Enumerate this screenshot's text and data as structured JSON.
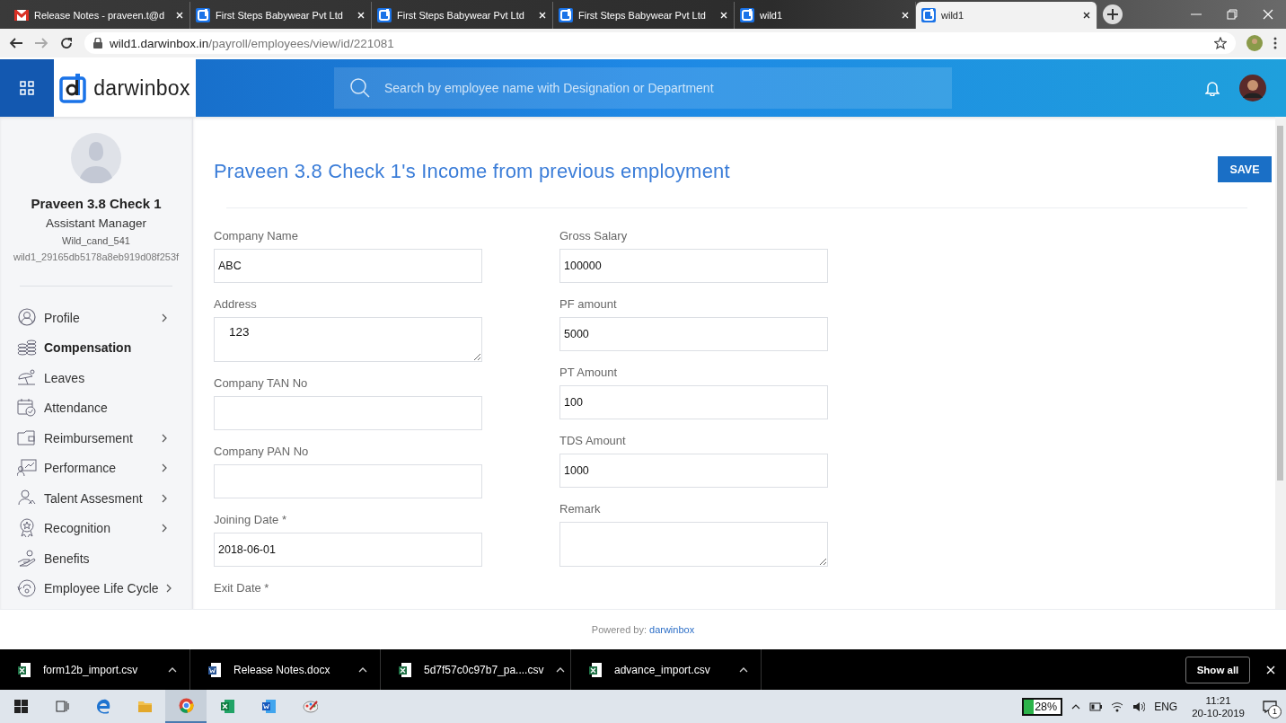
{
  "browser": {
    "tabs": [
      {
        "title": "Release Notes - praveen.t@d",
        "kind": "mail",
        "selected": false
      },
      {
        "title": "First Steps Babywear Pvt Ltd",
        "kind": "site",
        "selected": false
      },
      {
        "title": "First Steps Babywear Pvt Ltd",
        "kind": "site",
        "selected": false
      },
      {
        "title": "First Steps Babywear Pvt Ltd",
        "kind": "site",
        "selected": false
      },
      {
        "title": "wild1",
        "kind": "site",
        "selected": false
      },
      {
        "title": "wild1",
        "kind": "site",
        "selected": true
      }
    ],
    "host": "wild1.darwinbox.in",
    "path": "/payroll/employees/view/id/221081"
  },
  "header": {
    "logo": "darwinbox",
    "search_placeholder": "Search by employee name with Designation or Department"
  },
  "employee": {
    "name": "Praveen 3.8 Check 1",
    "designation": "Assistant Manager",
    "code": "Wild_cand_541",
    "id": "wild1_29165db5178a8eb919d08f253f"
  },
  "nav": [
    {
      "label": "Profile",
      "selected": false,
      "expandable": true
    },
    {
      "label": "Compensation",
      "selected": true,
      "expandable": false
    },
    {
      "label": "Leaves",
      "selected": false,
      "expandable": false
    },
    {
      "label": "Attendance",
      "selected": false,
      "expandable": false
    },
    {
      "label": "Reimbursement",
      "selected": false,
      "expandable": true
    },
    {
      "label": "Performance",
      "selected": false,
      "expandable": true
    },
    {
      "label": "Talent Assesment",
      "selected": false,
      "expandable": true
    },
    {
      "label": "Recognition",
      "selected": false,
      "expandable": true
    },
    {
      "label": "Benefits",
      "selected": false,
      "expandable": false
    },
    {
      "label": "Employee Life Cycle",
      "selected": false,
      "expandable": true
    }
  ],
  "form": {
    "title": "Praveen 3.8 Check 1's Income from previous employment",
    "save": "SAVE",
    "left": [
      {
        "label": "Company Name",
        "kind": "input",
        "value": "ABC"
      },
      {
        "label": "Address",
        "kind": "textarea",
        "value": "123"
      },
      {
        "label": "Company TAN No",
        "kind": "input"
      },
      {
        "label": "Company PAN No",
        "kind": "input"
      },
      {
        "label": "Joining Date *",
        "kind": "input",
        "value": "2018-06-01"
      },
      {
        "label": "Exit Date *",
        "kind": "label"
      }
    ],
    "right": [
      {
        "label": "Gross Salary",
        "kind": "input",
        "value": "100000"
      },
      {
        "label": "PF amount",
        "kind": "input",
        "value": "5000"
      },
      {
        "label": "PT Amount",
        "kind": "input",
        "value": "100"
      },
      {
        "label": "TDS Amount",
        "kind": "input",
        "value": "1000"
      },
      {
        "label": "Remark",
        "kind": "textarea"
      }
    ]
  },
  "footer": {
    "prefix": "Powered by:",
    "link": "darwinbox"
  },
  "downloads": {
    "items": [
      {
        "name": "form12b_import.csv",
        "kind": "excel"
      },
      {
        "name": "Release Notes.docx",
        "kind": "word"
      },
      {
        "name": "5d7f57c0c97b7_pa....csv",
        "kind": "excel"
      },
      {
        "name": "advance_import.csv",
        "kind": "excel"
      }
    ],
    "show_all": "Show all"
  },
  "taskbar": {
    "apps": [
      {
        "kind": "start",
        "active": false
      },
      {
        "kind": "taskview",
        "active": false
      },
      {
        "kind": "edge",
        "active": false
      },
      {
        "kind": "folder",
        "active": false
      },
      {
        "kind": "chrome",
        "active": true
      },
      {
        "kind": "excel",
        "active": false
      },
      {
        "kind": "word",
        "active": false
      },
      {
        "kind": "paint",
        "active": false
      }
    ],
    "battery": "28%",
    "language": "ENG",
    "time": "11:21",
    "date": "20-10-2019",
    "notifications": "1"
  }
}
